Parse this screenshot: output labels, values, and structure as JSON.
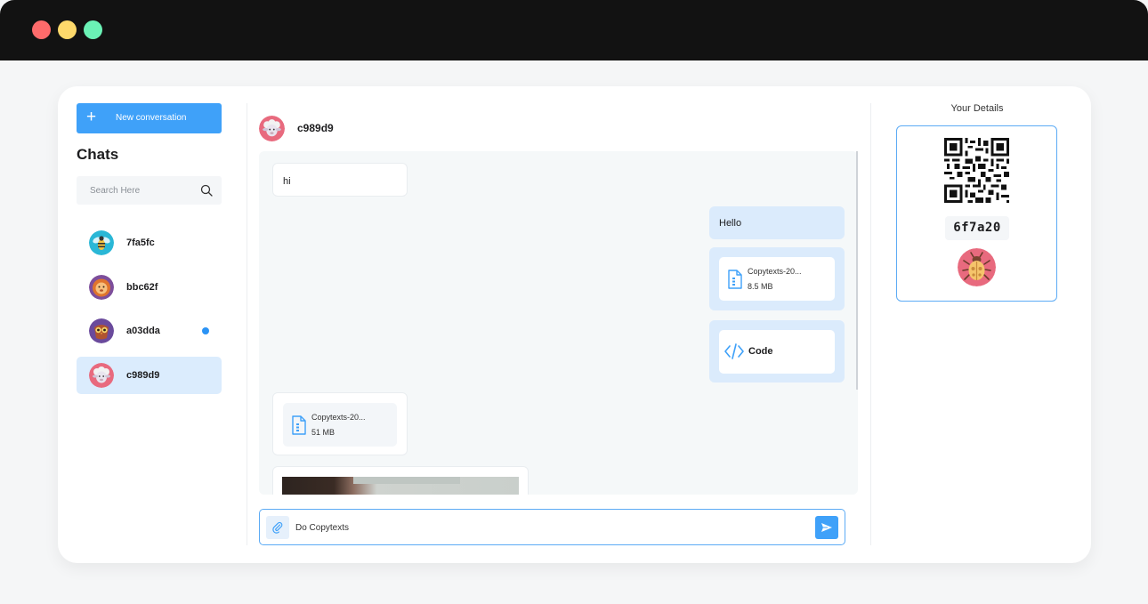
{
  "window": {
    "controls": [
      "close",
      "minimize",
      "maximize"
    ]
  },
  "sidebar": {
    "new_conversation_label": "New conversation",
    "title": "Chats",
    "search_placeholder": "Search Here",
    "chats": [
      {
        "name": "7fa5fc",
        "avatar": "bee-avatar",
        "unread": false,
        "active": false
      },
      {
        "name": "bbc62f",
        "avatar": "lion-avatar",
        "unread": false,
        "active": false
      },
      {
        "name": "a03dda",
        "avatar": "owl-avatar",
        "unread": true,
        "active": false
      },
      {
        "name": "c989d9",
        "avatar": "sheep-avatar",
        "unread": false,
        "active": true
      }
    ]
  },
  "chat": {
    "contact_name": "c989d9",
    "messages": [
      {
        "direction": "in",
        "type": "text",
        "text": "hi"
      },
      {
        "direction": "out",
        "type": "text",
        "text": "Hello"
      },
      {
        "direction": "out",
        "type": "file",
        "file_name": "Copytexts-20...",
        "file_size": "8.5 MB"
      },
      {
        "direction": "out",
        "type": "code",
        "label": "Code"
      },
      {
        "direction": "in",
        "type": "file",
        "file_name": "Copytexts-20...",
        "file_size": "51 MB"
      },
      {
        "direction": "in",
        "type": "image"
      }
    ],
    "composer_value": "Do Copytexts"
  },
  "details": {
    "title": "Your Details",
    "user_id": "6f7a20",
    "avatar": "beetle-avatar"
  },
  "colors": {
    "accent": "#3fa1f9",
    "bubble_out": "#dbebfc",
    "active_chat": "#dbecfd",
    "titlebar": "#121212"
  }
}
